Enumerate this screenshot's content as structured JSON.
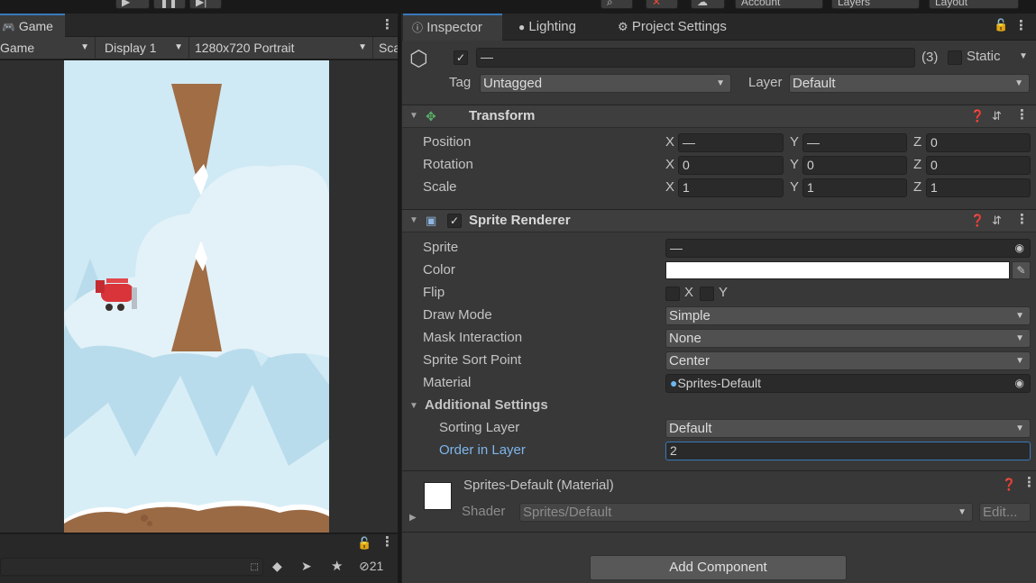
{
  "topbar": {
    "account_label": "Account",
    "layers_label": "Layers",
    "layout_label": "Layout"
  },
  "game": {
    "tab_label": "Game",
    "toolbar": {
      "mode": "Game",
      "display": "Display 1",
      "resolution": "1280x720 Portrait",
      "scale_label": "Sca"
    },
    "bottom": {
      "hidden_count": "21"
    }
  },
  "inspector": {
    "tabs": [
      "Inspector",
      "Lighting",
      "Project Settings"
    ],
    "object": {
      "name": "—",
      "count": "(3)",
      "static_label": "Static",
      "tag_label": "Tag",
      "tag_value": "Untagged",
      "layer_label": "Layer",
      "layer_value": "Default"
    },
    "transform": {
      "title": "Transform",
      "rows": [
        {
          "label": "Position",
          "x": "—",
          "y": "—",
          "z": "0"
        },
        {
          "label": "Rotation",
          "x": "0",
          "y": "0",
          "z": "0"
        },
        {
          "label": "Scale",
          "x": "1",
          "y": "1",
          "z": "1"
        }
      ],
      "axis_x": "X",
      "axis_y": "Y",
      "axis_z": "Z"
    },
    "sprite_renderer": {
      "title": "Sprite Renderer",
      "sprite_label": "Sprite",
      "sprite_value": "—",
      "color_label": "Color",
      "color_value": "#ffffff",
      "flip_label": "Flip",
      "flip_x": "X",
      "flip_y": "Y",
      "draw_mode_label": "Draw Mode",
      "draw_mode_value": "Simple",
      "mask_label": "Mask Interaction",
      "mask_value": "None",
      "sort_point_label": "Sprite Sort Point",
      "sort_point_value": "Center",
      "material_label": "Material",
      "material_value": "Sprites-Default",
      "additional_label": "Additional Settings",
      "sorting_layer_label": "Sorting Layer",
      "sorting_layer_value": "Default",
      "order_label": "Order in Layer",
      "order_value": "2"
    },
    "material": {
      "title": "Sprites-Default (Material)",
      "shader_label": "Shader",
      "shader_value": "Sprites/Default",
      "edit_label": "Edit..."
    },
    "add_component_label": "Add Component"
  },
  "colors": {
    "accent": "#3a79bb",
    "sky": "#cde8f3",
    "ground": "#9a6a45"
  }
}
